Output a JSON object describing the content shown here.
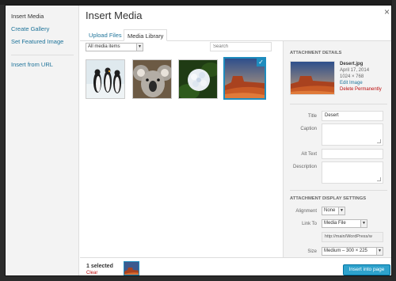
{
  "menu": {
    "items": [
      "Insert Media",
      "Create Gallery",
      "Set Featured Image",
      "Insert from URL"
    ]
  },
  "title": "Insert Media",
  "router": {
    "tabs": [
      "Upload Files",
      "Media Library"
    ]
  },
  "toolbar": {
    "filter_value": "All media items",
    "search_placeholder": "Search"
  },
  "attachments": [
    {
      "name": "penguins"
    },
    {
      "name": "koala"
    },
    {
      "name": "hydrangeas"
    },
    {
      "name": "desert",
      "selected": true
    }
  ],
  "details": {
    "heading": "Attachment Details",
    "filename": "Desert.jpg",
    "date": "April 17, 2014",
    "dimensions": "1024 × 768",
    "edit_link": "Edit Image",
    "delete_link": "Delete Permanently",
    "fields": {
      "title_label": "Title",
      "title_value": "Desert",
      "caption_label": "Caption",
      "alt_label": "Alt Text",
      "description_label": "Description"
    }
  },
  "display": {
    "heading": "Attachment Display Settings",
    "alignment_label": "Alignment",
    "alignment_value": "None",
    "link_label": "Link To",
    "link_value": "Media File",
    "url_value": "http://main/WordPress/w",
    "size_label": "Size",
    "size_value": "Medium – 300 × 225"
  },
  "footer": {
    "selected_count": "1 selected",
    "clear_label": "Clear",
    "insert_label": "Insert into page"
  },
  "colors": {
    "accent": "#21759b",
    "selected_border": "#1e8cbe",
    "primary_button": "#2ea2cc",
    "danger": "#bc0b0b"
  }
}
